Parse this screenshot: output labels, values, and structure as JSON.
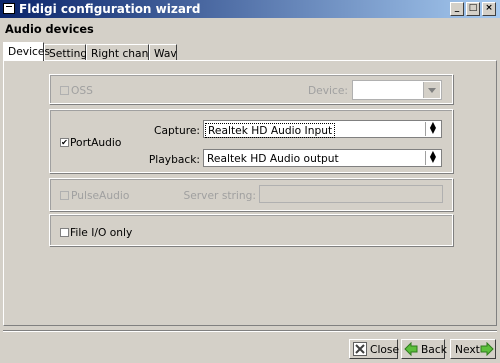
{
  "window": {
    "title": "Fldigi configuration wizard"
  },
  "header": {
    "title": "Audio devices"
  },
  "tabs": [
    {
      "label": "Devices"
    },
    {
      "label": "Settings"
    },
    {
      "label": "Right channel"
    },
    {
      "label": "Wav"
    }
  ],
  "oss": {
    "label": "OSS",
    "checked": false,
    "enabled": false,
    "device_label": "Device:",
    "device_value": ""
  },
  "portaudio": {
    "label": "PortAudio",
    "checked": true,
    "enabled": true,
    "capture_label": "Capture:",
    "capture_value": "Realtek HD Audio Input",
    "playback_label": "Playback:",
    "playback_value": "Realtek HD Audio output"
  },
  "pulseaudio": {
    "label": "PulseAudio",
    "checked": false,
    "enabled": false,
    "server_label": "Server string:",
    "server_value": ""
  },
  "fileio": {
    "label": "File I/O only",
    "checked": false
  },
  "buttons": {
    "close": "Close",
    "back": "Back",
    "next": "Next"
  },
  "colors": {
    "title_start": "#0a246a",
    "title_end": "#a6caf0",
    "face": "#d4d0c8",
    "disabled_text": "#a0a0a0",
    "arrow_green": "#3c9a2c"
  }
}
